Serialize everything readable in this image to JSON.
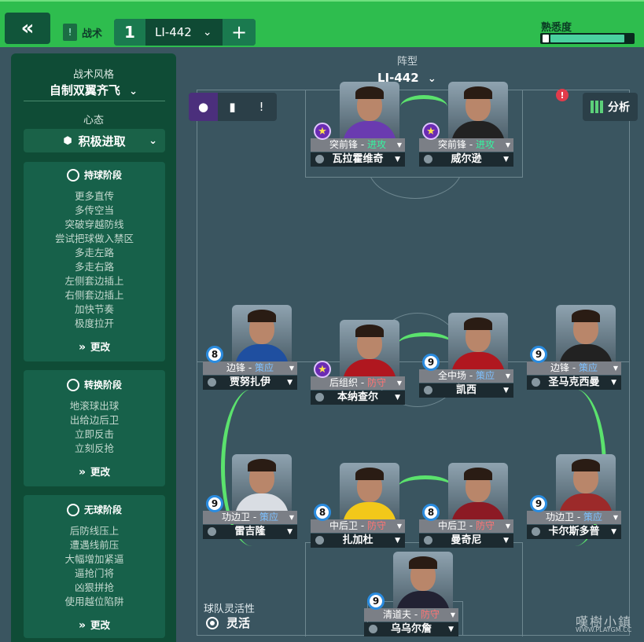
{
  "topbar": {
    "back_icon": "double-chevron-left",
    "tactics_label": "战术",
    "slot_number": "1",
    "slot_name": "LI-442",
    "add_label": "+",
    "familiarity_label": "熟悉度",
    "familiarity_level": 0.9
  },
  "sidebar": {
    "style_caption": "战术风格",
    "style_value": "自制双翼齐飞",
    "mentality_caption": "心态",
    "mentality_value": "积极进取",
    "phases": [
      {
        "title": "持球阶段",
        "icon": "ball-icon",
        "items": [
          "更多直传",
          "多传空当",
          "突破穿越防线",
          "尝试把球做入禁区",
          "多走左路",
          "多走右路",
          "左侧套边插上",
          "右侧套边插上",
          "加快节奏",
          "极度拉开"
        ],
        "change_label": "更改"
      },
      {
        "title": "转换阶段",
        "icon": "transition-icon",
        "items": [
          "地滚球出球",
          "出给边后卫",
          "立即反击",
          "立刻反抢"
        ],
        "change_label": "更改"
      },
      {
        "title": "无球阶段",
        "icon": "out-of-possession-icon",
        "items": [
          "后防线压上",
          "遭遇线前压",
          "大幅增加紧逼",
          "逼抢门将",
          "凶狠拼抢",
          "使用越位陷阱"
        ],
        "change_label": "更改"
      }
    ]
  },
  "pitch": {
    "heading": "阵型",
    "formation": "LI-442",
    "analysis_label": "分析",
    "flexibility_label": "球队灵活性",
    "flexibility_value": "灵活"
  },
  "players": [
    {
      "role": "突前锋",
      "duty": "进攻",
      "duty_class": "at",
      "name": "瓦拉霍维奇",
      "badge": "star",
      "shirt": "#6a3bb0"
    },
    {
      "role": "突前锋",
      "duty": "进攻",
      "duty_class": "at",
      "name": "威尔逊",
      "badge": "star",
      "shirt": "#222"
    },
    {
      "role": "边锋",
      "duty": "策应",
      "duty_class": "su",
      "name": "贾努扎伊",
      "badge": "8",
      "shirt": "#1f4fa0"
    },
    {
      "role": "后组织",
      "duty": "防守",
      "duty_class": "de",
      "name": "本纳查尔",
      "badge": "star",
      "shirt": "#b0171f"
    },
    {
      "role": "全中场",
      "duty": "策应",
      "duty_class": "su",
      "name": "凯西",
      "badge": "9",
      "shirt": "#b0171f"
    },
    {
      "role": "边锋",
      "duty": "策应",
      "duty_class": "su",
      "name": "圣马克西曼",
      "badge": "9",
      "shirt": "#222"
    },
    {
      "role": "功边卫",
      "duty": "策应",
      "duty_class": "su",
      "name": "雷吉隆",
      "badge": "9",
      "shirt": "#d9dde3"
    },
    {
      "role": "中后卫",
      "duty": "防守",
      "duty_class": "de",
      "name": "扎加杜",
      "badge": "8",
      "shirt": "#f2c81a"
    },
    {
      "role": "中后卫",
      "duty": "防守",
      "duty_class": "de",
      "name": "曼奇尼",
      "badge": "8",
      "shirt": "#8c1a24"
    },
    {
      "role": "功边卫",
      "duty": "策应",
      "duty_class": "su",
      "name": "卡尔斯多普",
      "badge": "9",
      "shirt": "#9c2a2a"
    },
    {
      "role": "清道夫",
      "duty": "防守",
      "duty_class": "de",
      "name": "乌乌尔詹",
      "badge": "9",
      "shirt": "#223"
    }
  ],
  "watermark": {
    "text": "嘆樹小鎮",
    "url": "WWW.PLAYGM.CC"
  }
}
